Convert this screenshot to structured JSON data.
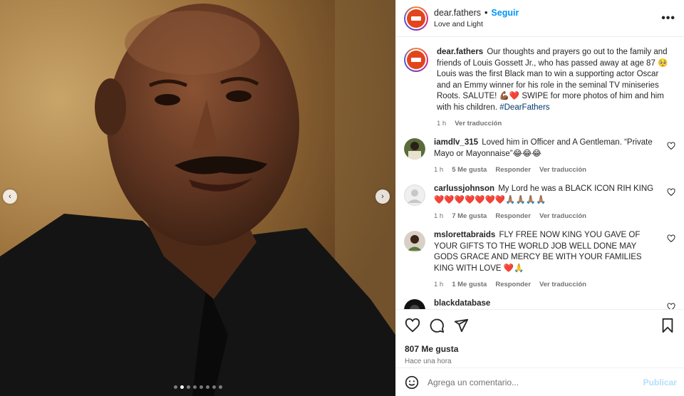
{
  "post": {
    "username": "dear.fathers",
    "follow_label": "Seguir",
    "subtitle": "Love and Light",
    "more_icon": "•••",
    "carousel": {
      "total": 8,
      "active_index": 1,
      "prev_icon": "‹",
      "next_icon": "›"
    }
  },
  "caption": {
    "username": "dear.fathers",
    "text": "Our thoughts and prayers go out to the family and friends of Louis Gossett Jr., who has passed away at age 87 🥺 Louis was the first Black man to win a supporting actor Oscar and an Emmy winner for his role in the seminal TV miniseries Roots. SALUTE! 💪🏾❤️ SWIPE for more photos of him and him with his children.",
    "hashtag": "#DearFathers",
    "time": "1 h",
    "translate": "Ver traducción"
  },
  "comments": [
    {
      "username": "iamdlv_315",
      "text": "Loved him in Officer and A Gentleman. “Private Mayo or Mayonnaise”😂😂😂",
      "time": "1 h",
      "likes": "5 Me gusta",
      "reply": "Responder",
      "translate": "Ver traducción"
    },
    {
      "username": "carlussjohnson",
      "text": "My Lord he was a BLACK ICON RIH KING❤️❤️❤️❤️❤️❤️❤️🙏🏽🙏🏽🙏🏽🙏🏽",
      "time": "1 h",
      "likes": "7 Me gusta",
      "reply": "Responder",
      "translate": "Ver traducción"
    },
    {
      "username": "mslorettabraids",
      "text": "FLY FREE NOW KING YOU GAVE OF YOUR GIFTS TO THE WORLD JOB WELL DONE MAY GODS GRACE AND MERCY BE WITH YOUR FAMILIES KING WITH LOVE ❤️🙏",
      "time": "1 h",
      "likes": "1 Me gusta",
      "reply": "Responder",
      "translate": "Ver traducción"
    },
    {
      "username": "blackdatabase",
      "text": "",
      "time": "",
      "likes": "",
      "reply": "",
      "translate": ""
    }
  ],
  "footer": {
    "likes": "807 Me gusta",
    "time": "Hace una hora",
    "comment_placeholder": "Agrega un comentario...",
    "post_label": "Publicar"
  },
  "colors": {
    "follow": "#0095f6",
    "avatar_brand": "#e2451d",
    "like_red": "#ed4956"
  }
}
